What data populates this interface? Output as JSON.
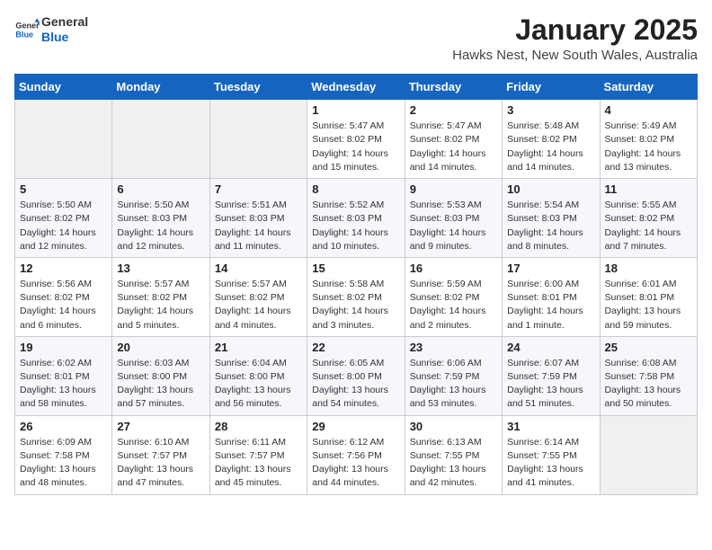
{
  "header": {
    "logo_line1": "General",
    "logo_line2": "Blue",
    "month": "January 2025",
    "location": "Hawks Nest, New South Wales, Australia"
  },
  "weekdays": [
    "Sunday",
    "Monday",
    "Tuesday",
    "Wednesday",
    "Thursday",
    "Friday",
    "Saturday"
  ],
  "weeks": [
    [
      {
        "day": "",
        "info": ""
      },
      {
        "day": "",
        "info": ""
      },
      {
        "day": "",
        "info": ""
      },
      {
        "day": "1",
        "info": "Sunrise: 5:47 AM\nSunset: 8:02 PM\nDaylight: 14 hours\nand 15 minutes."
      },
      {
        "day": "2",
        "info": "Sunrise: 5:47 AM\nSunset: 8:02 PM\nDaylight: 14 hours\nand 14 minutes."
      },
      {
        "day": "3",
        "info": "Sunrise: 5:48 AM\nSunset: 8:02 PM\nDaylight: 14 hours\nand 14 minutes."
      },
      {
        "day": "4",
        "info": "Sunrise: 5:49 AM\nSunset: 8:02 PM\nDaylight: 14 hours\nand 13 minutes."
      }
    ],
    [
      {
        "day": "5",
        "info": "Sunrise: 5:50 AM\nSunset: 8:02 PM\nDaylight: 14 hours\nand 12 minutes."
      },
      {
        "day": "6",
        "info": "Sunrise: 5:50 AM\nSunset: 8:03 PM\nDaylight: 14 hours\nand 12 minutes."
      },
      {
        "day": "7",
        "info": "Sunrise: 5:51 AM\nSunset: 8:03 PM\nDaylight: 14 hours\nand 11 minutes."
      },
      {
        "day": "8",
        "info": "Sunrise: 5:52 AM\nSunset: 8:03 PM\nDaylight: 14 hours\nand 10 minutes."
      },
      {
        "day": "9",
        "info": "Sunrise: 5:53 AM\nSunset: 8:03 PM\nDaylight: 14 hours\nand 9 minutes."
      },
      {
        "day": "10",
        "info": "Sunrise: 5:54 AM\nSunset: 8:03 PM\nDaylight: 14 hours\nand 8 minutes."
      },
      {
        "day": "11",
        "info": "Sunrise: 5:55 AM\nSunset: 8:02 PM\nDaylight: 14 hours\nand 7 minutes."
      }
    ],
    [
      {
        "day": "12",
        "info": "Sunrise: 5:56 AM\nSunset: 8:02 PM\nDaylight: 14 hours\nand 6 minutes."
      },
      {
        "day": "13",
        "info": "Sunrise: 5:57 AM\nSunset: 8:02 PM\nDaylight: 14 hours\nand 5 minutes."
      },
      {
        "day": "14",
        "info": "Sunrise: 5:57 AM\nSunset: 8:02 PM\nDaylight: 14 hours\nand 4 minutes."
      },
      {
        "day": "15",
        "info": "Sunrise: 5:58 AM\nSunset: 8:02 PM\nDaylight: 14 hours\nand 3 minutes."
      },
      {
        "day": "16",
        "info": "Sunrise: 5:59 AM\nSunset: 8:02 PM\nDaylight: 14 hours\nand 2 minutes."
      },
      {
        "day": "17",
        "info": "Sunrise: 6:00 AM\nSunset: 8:01 PM\nDaylight: 14 hours\nand 1 minute."
      },
      {
        "day": "18",
        "info": "Sunrise: 6:01 AM\nSunset: 8:01 PM\nDaylight: 13 hours\nand 59 minutes."
      }
    ],
    [
      {
        "day": "19",
        "info": "Sunrise: 6:02 AM\nSunset: 8:01 PM\nDaylight: 13 hours\nand 58 minutes."
      },
      {
        "day": "20",
        "info": "Sunrise: 6:03 AM\nSunset: 8:00 PM\nDaylight: 13 hours\nand 57 minutes."
      },
      {
        "day": "21",
        "info": "Sunrise: 6:04 AM\nSunset: 8:00 PM\nDaylight: 13 hours\nand 56 minutes."
      },
      {
        "day": "22",
        "info": "Sunrise: 6:05 AM\nSunset: 8:00 PM\nDaylight: 13 hours\nand 54 minutes."
      },
      {
        "day": "23",
        "info": "Sunrise: 6:06 AM\nSunset: 7:59 PM\nDaylight: 13 hours\nand 53 minutes."
      },
      {
        "day": "24",
        "info": "Sunrise: 6:07 AM\nSunset: 7:59 PM\nDaylight: 13 hours\nand 51 minutes."
      },
      {
        "day": "25",
        "info": "Sunrise: 6:08 AM\nSunset: 7:58 PM\nDaylight: 13 hours\nand 50 minutes."
      }
    ],
    [
      {
        "day": "26",
        "info": "Sunrise: 6:09 AM\nSunset: 7:58 PM\nDaylight: 13 hours\nand 48 minutes."
      },
      {
        "day": "27",
        "info": "Sunrise: 6:10 AM\nSunset: 7:57 PM\nDaylight: 13 hours\nand 47 minutes."
      },
      {
        "day": "28",
        "info": "Sunrise: 6:11 AM\nSunset: 7:57 PM\nDaylight: 13 hours\nand 45 minutes."
      },
      {
        "day": "29",
        "info": "Sunrise: 6:12 AM\nSunset: 7:56 PM\nDaylight: 13 hours\nand 44 minutes."
      },
      {
        "day": "30",
        "info": "Sunrise: 6:13 AM\nSunset: 7:55 PM\nDaylight: 13 hours\nand 42 minutes."
      },
      {
        "day": "31",
        "info": "Sunrise: 6:14 AM\nSunset: 7:55 PM\nDaylight: 13 hours\nand 41 minutes."
      },
      {
        "day": "",
        "info": ""
      }
    ]
  ]
}
